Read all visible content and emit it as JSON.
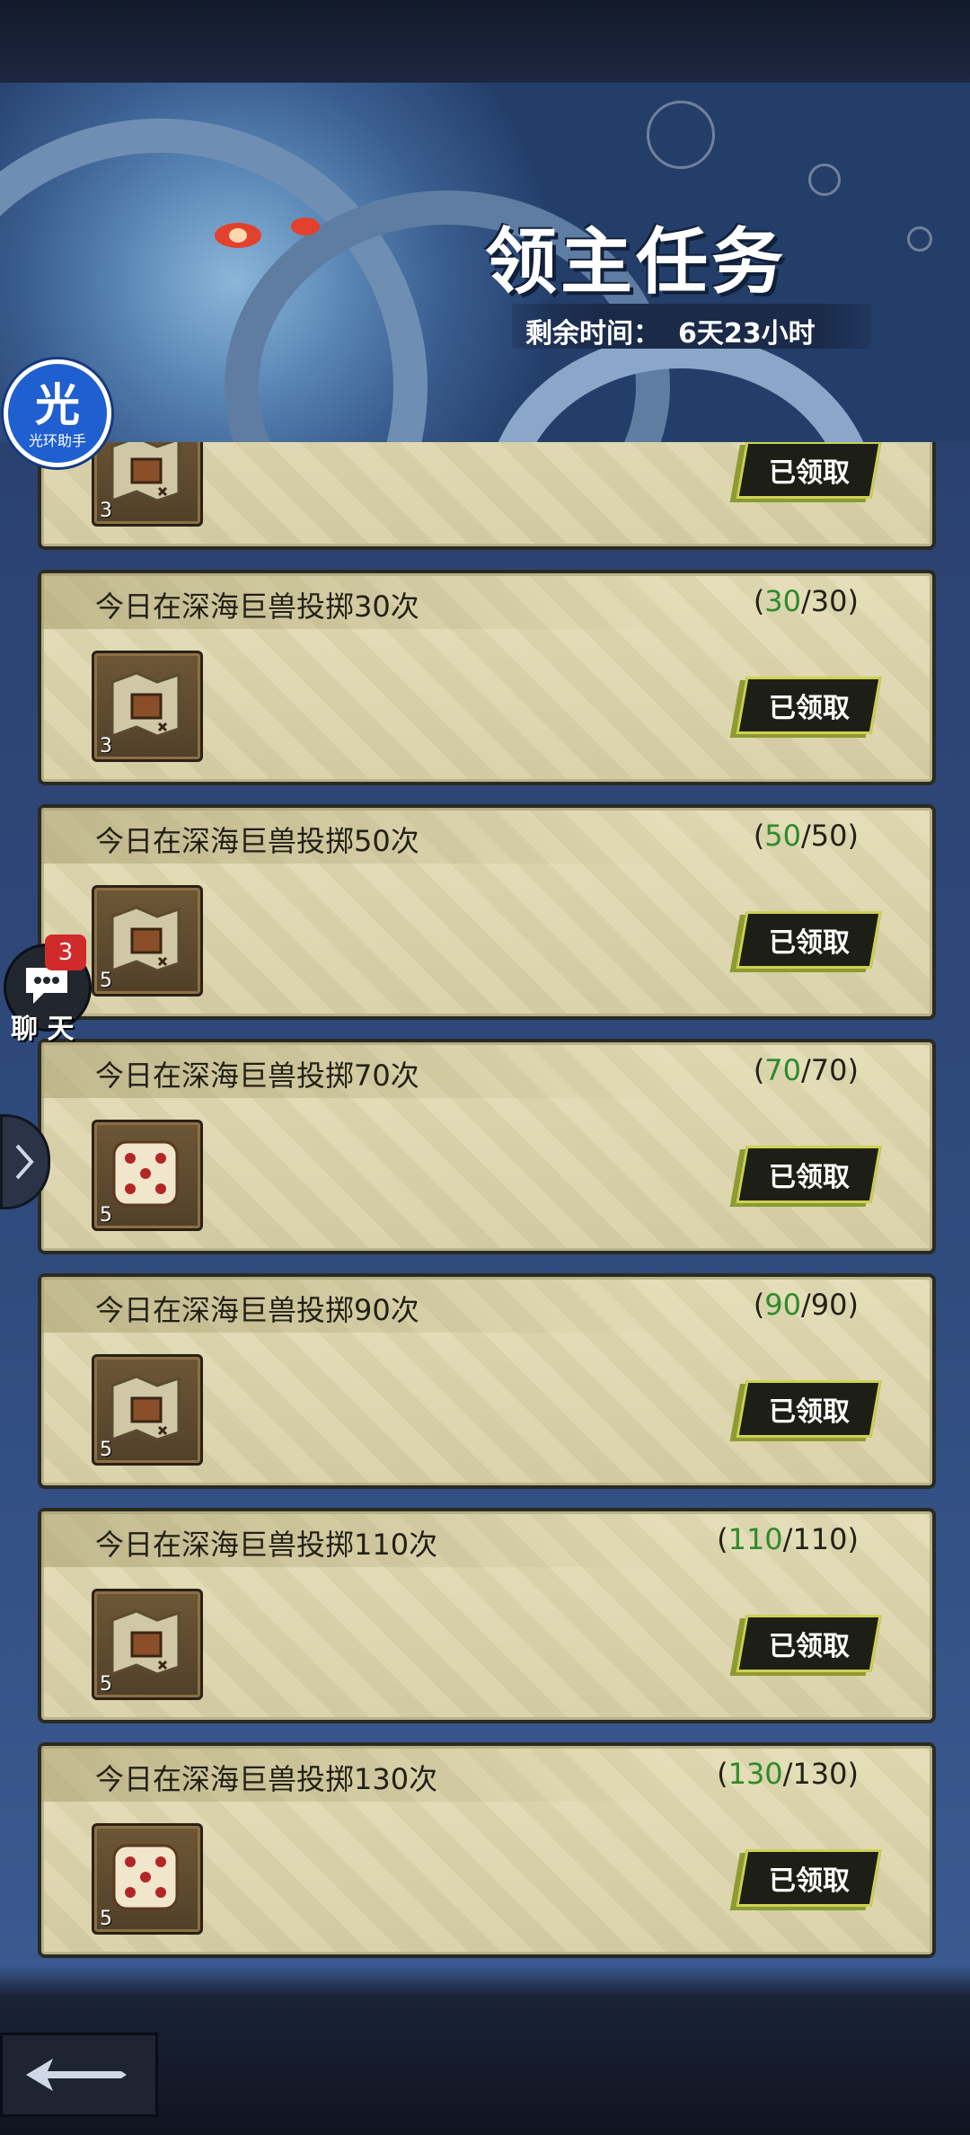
{
  "header": {
    "title": "领主任务",
    "remaining_label": "剩余时间：",
    "remaining_value": "6天23小时"
  },
  "side": {
    "helper_badge_char": "光",
    "helper_badge_label": "光环助手",
    "chat_count": "3",
    "chat_label": "聊 天"
  },
  "tasks": [
    {
      "title": "",
      "progress_done": "",
      "progress_total": "",
      "reward_count": "3",
      "reward_icon": "treasure-map-icon",
      "status": "已领取"
    },
    {
      "title": "今日在深海巨兽投掷30次",
      "progress_done": "30",
      "progress_total": "30",
      "reward_count": "3",
      "reward_icon": "treasure-map-icon",
      "status": "已领取"
    },
    {
      "title": "今日在深海巨兽投掷50次",
      "progress_done": "50",
      "progress_total": "50",
      "reward_count": "5",
      "reward_icon": "treasure-map-icon",
      "status": "已领取"
    },
    {
      "title": "今日在深海巨兽投掷70次",
      "progress_done": "70",
      "progress_total": "70",
      "reward_count": "5",
      "reward_icon": "dice-icon",
      "status": "已领取"
    },
    {
      "title": "今日在深海巨兽投掷90次",
      "progress_done": "90",
      "progress_total": "90",
      "reward_count": "5",
      "reward_icon": "treasure-map-icon",
      "status": "已领取"
    },
    {
      "title": "今日在深海巨兽投掷110次",
      "progress_done": "110",
      "progress_total": "110",
      "reward_count": "5",
      "reward_icon": "treasure-map-icon",
      "status": "已领取"
    },
    {
      "title": "今日在深海巨兽投掷130次",
      "progress_done": "130",
      "progress_total": "130",
      "reward_count": "5",
      "reward_icon": "dice-icon",
      "status": "已领取"
    }
  ]
}
